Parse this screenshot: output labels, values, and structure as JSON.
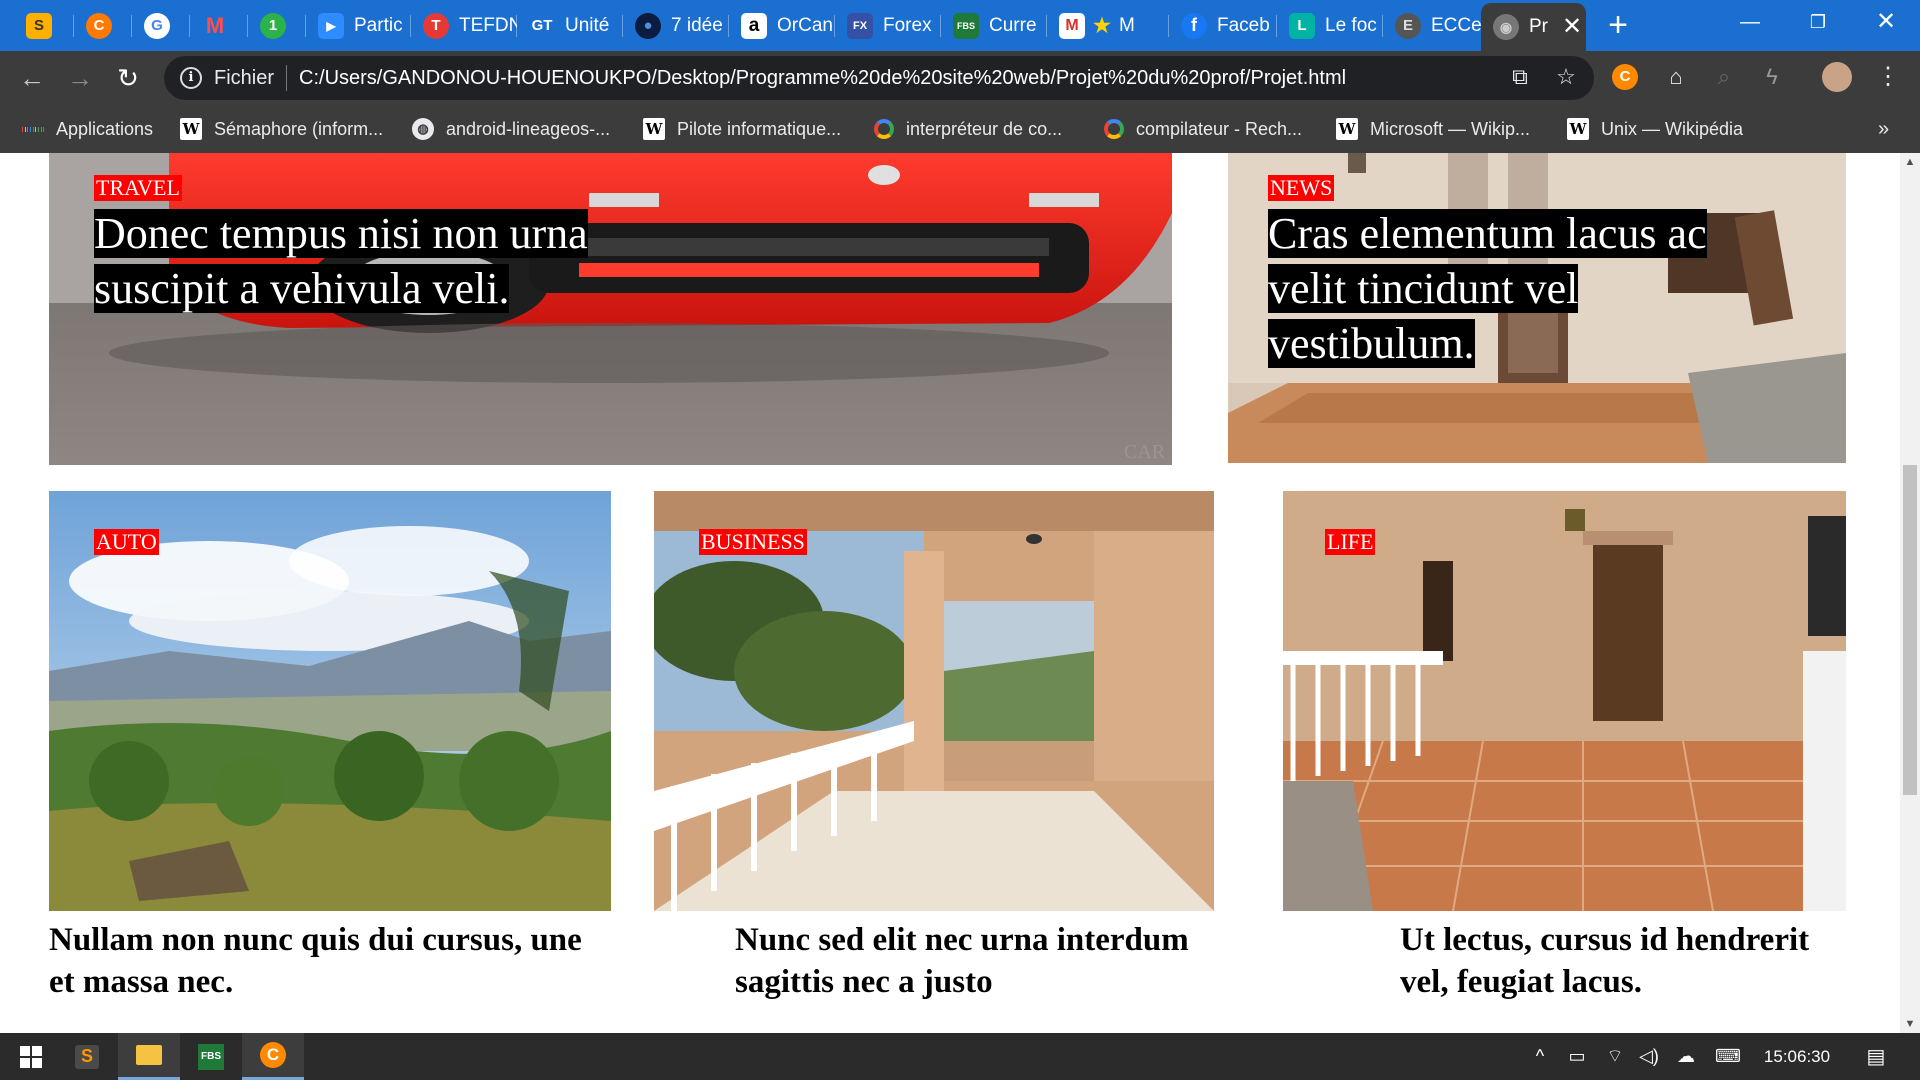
{
  "browser": {
    "tabs": [
      {
        "label": "",
        "icon": "sublime-icon",
        "color": "#ffb000",
        "glyph": "S"
      },
      {
        "label": "",
        "icon": "chrome-extension-c-icon",
        "color": "#ff7a00",
        "glyph": "C"
      },
      {
        "label": "",
        "icon": "google-icon",
        "color": "#ffffff",
        "glyph": "G"
      },
      {
        "label": "",
        "icon": "m-logo-icon",
        "color": "#ffffff",
        "glyph": "M"
      },
      {
        "label": "",
        "icon": "one-icon",
        "color": "#2bb34a",
        "glyph": "1"
      },
      {
        "label": "Partic",
        "icon": "zoom-icon",
        "color": "#2d8cff",
        "glyph": "▶"
      },
      {
        "label": "TEFDN",
        "icon": "tefd-icon",
        "color": "#e53935",
        "glyph": "T"
      },
      {
        "label": "Unité",
        "icon": "gt-icon",
        "color": "#3c3c3c",
        "glyph": "GT"
      },
      {
        "label": "7 idée",
        "icon": "dot-icon",
        "color": "#1a3f8f",
        "glyph": "●"
      },
      {
        "label": "OrCan",
        "icon": "amazon-icon",
        "color": "#ffffff",
        "glyph": "a"
      },
      {
        "label": "Forex",
        "icon": "forex-icon",
        "color": "#3551a6",
        "glyph": "F"
      },
      {
        "label": "Curre",
        "icon": "fbs-icon",
        "color": "#1f7a3a",
        "glyph": "FBS"
      },
      {
        "label": "M",
        "icon": "gmail-icon",
        "color": "#ffffff",
        "glyph": "M"
      },
      {
        "label": "Faceb",
        "icon": "facebook-icon",
        "color": "#1877f2",
        "glyph": "f"
      },
      {
        "label": "Le foc",
        "icon": "lefoc-icon",
        "color": "#00b3a4",
        "glyph": "L"
      },
      {
        "label": "ECCel",
        "icon": "eccel-icon",
        "color": "#6d6d6d",
        "glyph": "E"
      },
      {
        "label": "Pr",
        "icon": "globe-icon",
        "color": "#888888",
        "glyph": "◉",
        "active": true
      }
    ],
    "new_tab": "+",
    "address": {
      "scheme": "Fichier",
      "url": "C:/Users/GANDONOU-HOUENOUKPO/Desktop/Programme%20de%20site%20web/Projet%20du%20prof/Projet.html"
    },
    "bookmarks": [
      {
        "label": "Applications",
        "icon": "apps-grid-icon"
      },
      {
        "label": "Sémaphore (inform...",
        "icon": "wikipedia-icon"
      },
      {
        "label": "android-lineageos-...",
        "icon": "globe-icon"
      },
      {
        "label": "Pilote informatique...",
        "icon": "wikipedia-icon"
      },
      {
        "label": "interpréteur de co...",
        "icon": "google-icon"
      },
      {
        "label": "compilateur - Rech...",
        "icon": "google-icon"
      },
      {
        "label": "Microsoft — Wikip...",
        "icon": "wikipedia-icon"
      },
      {
        "label": "Unix — Wikipédia",
        "icon": "wikipedia-icon"
      }
    ],
    "bookmarks_overflow": "»"
  },
  "page": {
    "top_features": [
      {
        "tag": "TRAVEL",
        "title": "Donec tempus nisi non urna suscipit a vehivula veli.",
        "image": "red-car-front",
        "watermark": "CAR"
      },
      {
        "tag": "NEWS",
        "title": "Cras elementum lacus ac velit tincidunt vel vestibulum.",
        "image": "villa-entrance"
      }
    ],
    "cards": [
      {
        "tag": "AUTO",
        "caption": "Nullam non nunc quis dui cursus, une et massa nec.",
        "image": "mountain-landscape"
      },
      {
        "tag": "BUSINESS",
        "caption": "Nunc sed elit nec urna interdum sagittis nec a justo",
        "image": "covered-balcony"
      },
      {
        "tag": "LIFE",
        "caption": "Ut lectus, cursus id hendrerit vel, feugiat lacus.",
        "image": "tiled-terrace"
      }
    ],
    "colors": {
      "tag_bg": "#ff0000",
      "title_bg": "#000000"
    }
  },
  "taskbar": {
    "apps": [
      {
        "name": "windows-start-icon"
      },
      {
        "name": "sublime-text-icon"
      },
      {
        "name": "file-explorer-icon",
        "active": true
      },
      {
        "name": "fbs-trader-icon"
      },
      {
        "name": "c-browser-icon",
        "active": true
      }
    ],
    "time": "15:06:30"
  }
}
